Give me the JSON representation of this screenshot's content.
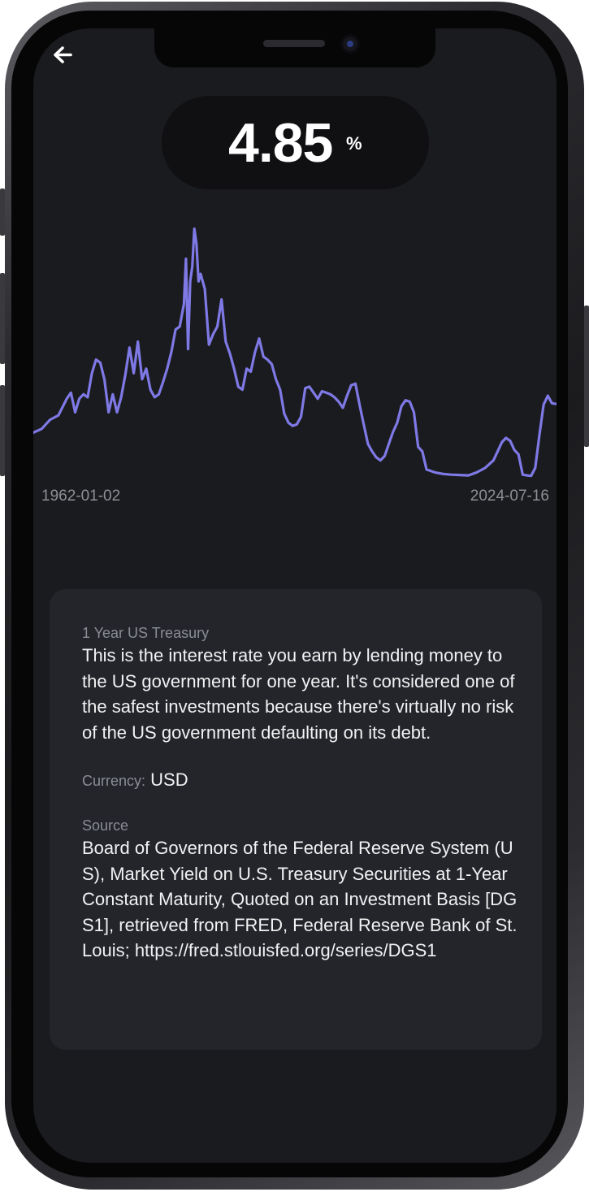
{
  "header": {
    "back_icon": "arrow-left-icon"
  },
  "rate": {
    "value": "4.85",
    "unit": "%"
  },
  "chart": {
    "start_date": "1962-01-02",
    "end_date": "2024-07-16",
    "line_color": "#7f79e6"
  },
  "chart_data": {
    "type": "line",
    "title": "",
    "xlabel": "",
    "ylabel": "",
    "x_range": [
      "1962-01-02",
      "2024-07-16"
    ],
    "ylim": [
      0,
      17.5
    ],
    "grid": false,
    "series": [
      {
        "x": [
          1962.0,
          1963.0,
          1964.0,
          1965.0,
          1966.0,
          1966.5,
          1967.0,
          1967.5,
          1968.0,
          1968.5,
          1969.0,
          1969.5,
          1970.0,
          1970.5,
          1971.0,
          1971.5,
          1972.0,
          1972.5,
          1973.0,
          1973.5,
          1974.0,
          1974.5,
          1975.0,
          1975.5,
          1976.0,
          1976.5,
          1977.0,
          1977.5,
          1978.0,
          1978.5,
          1979.0,
          1979.5,
          1980.0,
          1980.25,
          1980.5,
          1980.75,
          1981.0,
          1981.25,
          1981.5,
          1981.75,
          1982.0,
          1982.5,
          1983.0,
          1983.5,
          1984.0,
          1984.5,
          1985.0,
          1985.5,
          1986.0,
          1986.5,
          1987.0,
          1987.5,
          1988.0,
          1988.5,
          1989.0,
          1989.5,
          1990.0,
          1990.5,
          1991.0,
          1991.5,
          1992.0,
          1992.5,
          1993.0,
          1993.5,
          1994.0,
          1994.5,
          1995.0,
          1995.5,
          1996.0,
          1996.5,
          1997.0,
          1997.5,
          1998.0,
          1998.5,
          1999.0,
          1999.5,
          2000.0,
          2000.5,
          2001.0,
          2001.5,
          2002.0,
          2002.5,
          2003.0,
          2003.5,
          2004.0,
          2004.5,
          2005.0,
          2005.5,
          2006.0,
          2006.5,
          2007.0,
          2007.5,
          2008.0,
          2008.5,
          2009.0,
          2010.0,
          2011.0,
          2012.0,
          2013.0,
          2014.0,
          2015.0,
          2016.0,
          2017.0,
          2018.0,
          2018.5,
          2019.0,
          2019.5,
          2020.0,
          2020.5,
          2021.0,
          2021.5,
          2022.0,
          2022.5,
          2023.0,
          2023.5,
          2024.0,
          2024.54
        ],
        "values": [
          2.95,
          3.2,
          3.8,
          4.1,
          5.2,
          5.6,
          4.3,
          5.2,
          5.5,
          5.3,
          6.9,
          7.8,
          7.6,
          6.5,
          4.3,
          5.5,
          4.3,
          5.3,
          6.8,
          8.6,
          6.9,
          9.0,
          6.5,
          7.2,
          5.8,
          5.3,
          5.5,
          6.3,
          7.2,
          8.3,
          9.8,
          10.0,
          11.5,
          14.5,
          8.5,
          13.0,
          14.0,
          16.5,
          15.5,
          13.0,
          13.5,
          12.5,
          8.8,
          9.5,
          10.0,
          11.8,
          9.0,
          8.2,
          7.2,
          6.0,
          5.8,
          7.2,
          7.0,
          8.3,
          9.2,
          8.0,
          7.8,
          7.5,
          6.5,
          5.8,
          4.2,
          3.6,
          3.4,
          3.5,
          4.0,
          5.9,
          6.0,
          5.6,
          5.2,
          5.7,
          5.6,
          5.5,
          5.3,
          5.0,
          4.6,
          5.4,
          6.1,
          6.2,
          4.8,
          3.5,
          2.2,
          1.7,
          1.3,
          1.1,
          1.4,
          2.2,
          3.0,
          3.6,
          4.7,
          5.1,
          5.0,
          4.3,
          2.0,
          1.7,
          0.5,
          0.3,
          0.2,
          0.15,
          0.13,
          0.1,
          0.3,
          0.6,
          1.1,
          2.3,
          2.6,
          2.4,
          1.8,
          1.5,
          0.15,
          0.1,
          0.07,
          0.6,
          2.8,
          4.8,
          5.4,
          4.9,
          4.85
        ]
      }
    ]
  },
  "info": {
    "title": "1 Year US Treasury",
    "description": "This is the interest rate you earn by lending money to the US government for one year. It's considered one of the safest investments because there's virtually no risk of the US government defaulting on its debt.",
    "currency_label": "Currency:",
    "currency_value": "USD",
    "source_label": "Source",
    "source_text": "Board of Governors of the Federal Reserve System (US), Market Yield on U.S. Treasury Securities at 1-Year Constant Maturity, Quoted on an Investment Basis [DGS1], retrieved from FRED, Federal Reserve Bank of St. Louis; https://fred.stlouisfed.org/series/DGS1"
  }
}
